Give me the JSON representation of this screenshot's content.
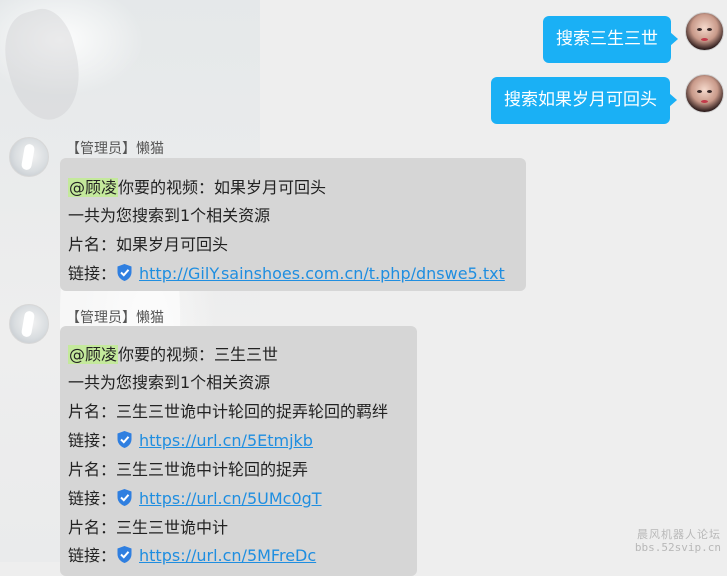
{
  "outgoing": [
    {
      "text": "搜索三生三世"
    },
    {
      "text": "搜索如果岁月可回头"
    }
  ],
  "incoming": [
    {
      "sender": "【管理员】懒猫",
      "mention": "@顾凌",
      "lines": [
        {
          "text": "你要的视频：如果岁月可回头"
        },
        {
          "text": "一共为您搜索到1个相关资源"
        },
        {
          "text": "片名：如果岁月可回头"
        },
        {
          "label": "链接：",
          "link": "http://GilY.sainshoes.com.cn/t.php/dnswe5.txt"
        }
      ]
    },
    {
      "sender": "【管理员】懒猫",
      "mention": "@顾凌",
      "lines": [
        {
          "text": "你要的视频：三生三世"
        },
        {
          "text": "一共为您搜索到1个相关资源"
        },
        {
          "text": "片名：三生三世诡中计轮回的捉弄轮回的羁绊"
        },
        {
          "label": "链接：",
          "link": "https://url.cn/5Etmjkb"
        },
        {
          "text": "片名：三生三世诡中计轮回的捉弄"
        },
        {
          "label": "链接：",
          "link": "https://url.cn/5UMc0gT"
        },
        {
          "text": "片名：三生三世诡中计"
        },
        {
          "label": "链接：",
          "link": "https://url.cn/5MFreDc"
        }
      ]
    }
  ],
  "watermark": {
    "line1": "晨风机器人论坛",
    "line2": "bbs.52svip.cn"
  },
  "colors": {
    "outgoing_bubble": "#1ab0f5",
    "incoming_bubble": "#d6d6d6",
    "link": "#1f8ee0",
    "mention_highlight": "#c4e99c"
  }
}
